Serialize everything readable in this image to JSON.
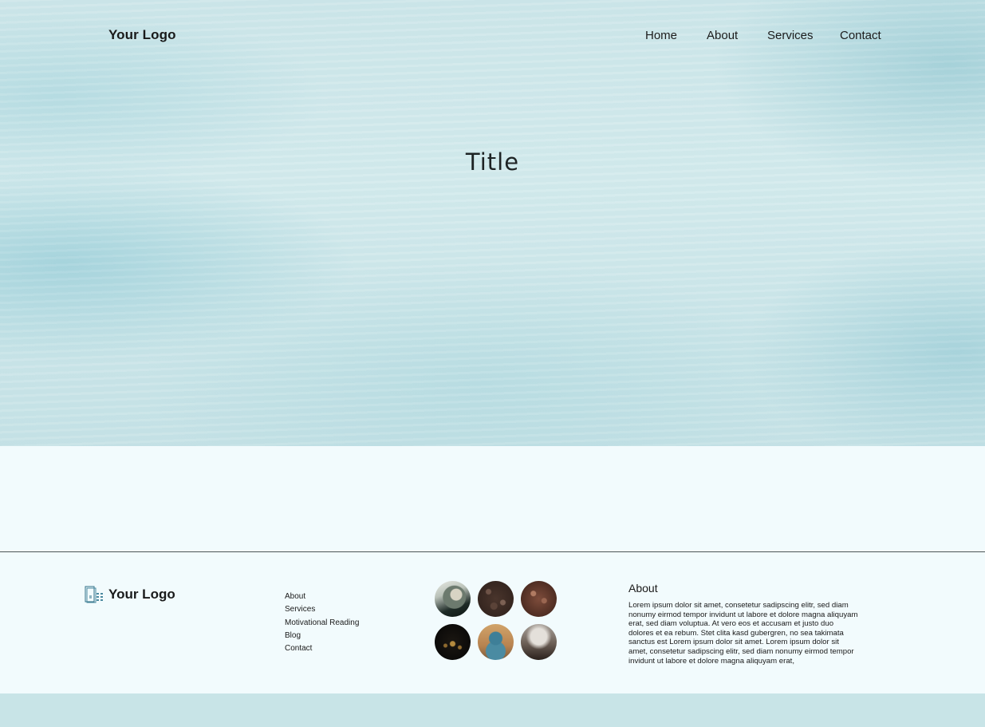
{
  "header": {
    "logo": "Your Logo",
    "nav": [
      "Home",
      "About",
      "Services",
      "Contact"
    ]
  },
  "hero": {
    "title": "Title"
  },
  "footer": {
    "logo": "Your Logo",
    "logo_icon": "logo-book-icon",
    "links": [
      "About",
      "Services",
      "Motivational Reading",
      "Blog",
      "Contact"
    ],
    "gallery": [
      "gallery-image-1",
      "gallery-image-2",
      "gallery-image-3",
      "gallery-image-4",
      "gallery-image-5",
      "gallery-image-6"
    ],
    "about": {
      "heading": "About",
      "text": "Lorem ipsum dolor sit amet, consetetur sadipscing elitr, sed diam nonumy eirmod tempor invidunt ut labore et dolore magna aliquyam erat, sed diam voluptua. At vero eos et accusam et justo duo dolores et ea rebum. Stet clita kasd gubergren, no sea takimata sanctus est Lorem ipsum dolor sit amet. Lorem ipsum dolor sit amet, consetetur sadipscing elitr, sed diam nonumy eirmod tempor invidunt ut labore et dolore magna aliquyam erat,"
    }
  },
  "colors": {
    "page_background": "#f2fbfd",
    "bottom_bar": "#c8e4e7",
    "text": "#1a1a1a",
    "hero_tint": "#cfe7ea"
  }
}
